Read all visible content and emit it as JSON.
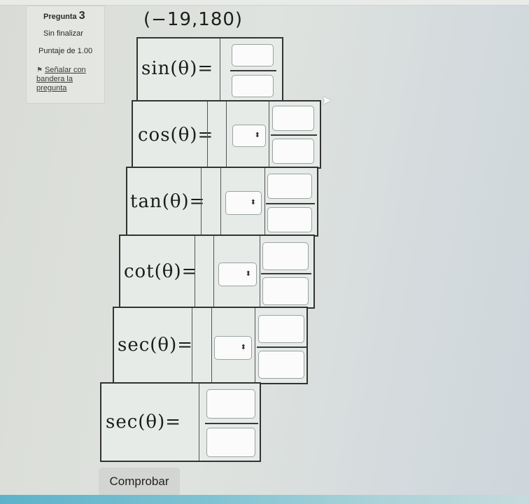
{
  "question": {
    "label": "Pregunta",
    "number": "3",
    "state": "Sin finalizar",
    "score": "Puntaje de 1.00",
    "flag_label_1": "Señalar con",
    "flag_label_2": "bandera la",
    "flag_label_3": "pregunta"
  },
  "point": "(−19,180)",
  "rows": [
    {
      "label": "sin(θ)="
    },
    {
      "label": "cos(θ)="
    },
    {
      "label": "tan(θ)="
    },
    {
      "label": "cot(θ)="
    },
    {
      "label": "sec(θ)="
    },
    {
      "label": "sec(θ)="
    }
  ],
  "select_arrow": "⬍",
  "submit_label": "Comprobar"
}
